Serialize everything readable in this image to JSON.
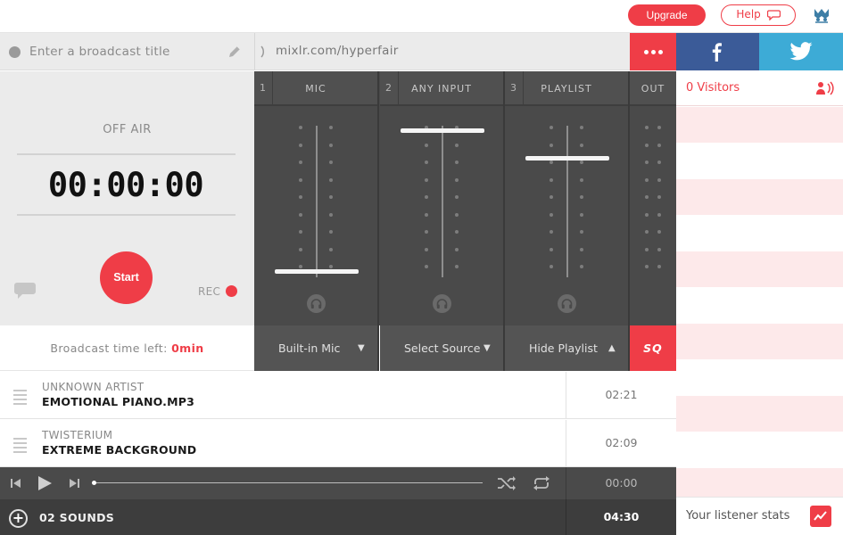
{
  "header": {
    "upgrade_label": "Upgrade",
    "help_label": "Help",
    "logo_icon": "mixlr-logo-icon"
  },
  "broadcast": {
    "title_placeholder": "Enter a broadcast title",
    "url": "mixlr.com/hyperfair",
    "status": "OFF AIR",
    "timer": "00:00:00",
    "start_label": "Start",
    "rec_label": "REC",
    "time_left_label": "Broadcast time left:",
    "time_left_value": "0min"
  },
  "social": {
    "facebook_icon": "facebook-icon",
    "twitter_icon": "twitter-icon"
  },
  "mixer": {
    "channels": [
      {
        "number": "1",
        "name": "MIC",
        "source": "Built-in Mic",
        "level": 0.04
      },
      {
        "number": "2",
        "name": "ANY INPUT",
        "source": "Select Source",
        "level": 0.97
      },
      {
        "number": "3",
        "name": "PLAYLIST",
        "source": "Hide Playlist",
        "level": 0.79
      }
    ],
    "out_label": "OUT",
    "sq_label": "SQ"
  },
  "playlist": {
    "tracks": [
      {
        "artist": "UNKNOWN ARTIST",
        "title": "EMOTIONAL PIANO.MP3",
        "duration": "02:21"
      },
      {
        "artist": "TWISTERIUM",
        "title": "EXTREME BACKGROUND",
        "duration": "02:09"
      }
    ],
    "current_time": "00:00",
    "count_label": "02 SOUNDS",
    "total_duration": "04:30"
  },
  "listeners": {
    "visitors_label": "0 Visitors",
    "stats_label": "Your listener stats"
  },
  "colors": {
    "accent": "#ef3d47",
    "facebook": "#3b5b98",
    "twitter": "#3dabd6",
    "mixer_bg": "#4a4a4a"
  }
}
